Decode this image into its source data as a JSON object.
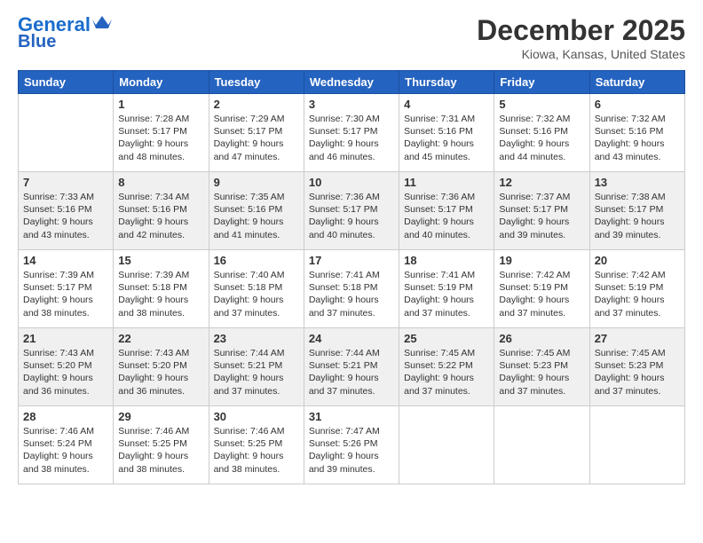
{
  "header": {
    "logo_line1": "General",
    "logo_line2": "Blue",
    "month": "December 2025",
    "location": "Kiowa, Kansas, United States"
  },
  "weekdays": [
    "Sunday",
    "Monday",
    "Tuesday",
    "Wednesday",
    "Thursday",
    "Friday",
    "Saturday"
  ],
  "weeks": [
    [
      {
        "day": "",
        "info": ""
      },
      {
        "day": "1",
        "info": "Sunrise: 7:28 AM\nSunset: 5:17 PM\nDaylight: 9 hours\nand 48 minutes."
      },
      {
        "day": "2",
        "info": "Sunrise: 7:29 AM\nSunset: 5:17 PM\nDaylight: 9 hours\nand 47 minutes."
      },
      {
        "day": "3",
        "info": "Sunrise: 7:30 AM\nSunset: 5:17 PM\nDaylight: 9 hours\nand 46 minutes."
      },
      {
        "day": "4",
        "info": "Sunrise: 7:31 AM\nSunset: 5:16 PM\nDaylight: 9 hours\nand 45 minutes."
      },
      {
        "day": "5",
        "info": "Sunrise: 7:32 AM\nSunset: 5:16 PM\nDaylight: 9 hours\nand 44 minutes."
      },
      {
        "day": "6",
        "info": "Sunrise: 7:32 AM\nSunset: 5:16 PM\nDaylight: 9 hours\nand 43 minutes."
      }
    ],
    [
      {
        "day": "7",
        "info": "Sunrise: 7:33 AM\nSunset: 5:16 PM\nDaylight: 9 hours\nand 43 minutes."
      },
      {
        "day": "8",
        "info": "Sunrise: 7:34 AM\nSunset: 5:16 PM\nDaylight: 9 hours\nand 42 minutes."
      },
      {
        "day": "9",
        "info": "Sunrise: 7:35 AM\nSunset: 5:16 PM\nDaylight: 9 hours\nand 41 minutes."
      },
      {
        "day": "10",
        "info": "Sunrise: 7:36 AM\nSunset: 5:17 PM\nDaylight: 9 hours\nand 40 minutes."
      },
      {
        "day": "11",
        "info": "Sunrise: 7:36 AM\nSunset: 5:17 PM\nDaylight: 9 hours\nand 40 minutes."
      },
      {
        "day": "12",
        "info": "Sunrise: 7:37 AM\nSunset: 5:17 PM\nDaylight: 9 hours\nand 39 minutes."
      },
      {
        "day": "13",
        "info": "Sunrise: 7:38 AM\nSunset: 5:17 PM\nDaylight: 9 hours\nand 39 minutes."
      }
    ],
    [
      {
        "day": "14",
        "info": "Sunrise: 7:39 AM\nSunset: 5:17 PM\nDaylight: 9 hours\nand 38 minutes."
      },
      {
        "day": "15",
        "info": "Sunrise: 7:39 AM\nSunset: 5:18 PM\nDaylight: 9 hours\nand 38 minutes."
      },
      {
        "day": "16",
        "info": "Sunrise: 7:40 AM\nSunset: 5:18 PM\nDaylight: 9 hours\nand 37 minutes."
      },
      {
        "day": "17",
        "info": "Sunrise: 7:41 AM\nSunset: 5:18 PM\nDaylight: 9 hours\nand 37 minutes."
      },
      {
        "day": "18",
        "info": "Sunrise: 7:41 AM\nSunset: 5:19 PM\nDaylight: 9 hours\nand 37 minutes."
      },
      {
        "day": "19",
        "info": "Sunrise: 7:42 AM\nSunset: 5:19 PM\nDaylight: 9 hours\nand 37 minutes."
      },
      {
        "day": "20",
        "info": "Sunrise: 7:42 AM\nSunset: 5:19 PM\nDaylight: 9 hours\nand 37 minutes."
      }
    ],
    [
      {
        "day": "21",
        "info": "Sunrise: 7:43 AM\nSunset: 5:20 PM\nDaylight: 9 hours\nand 36 minutes."
      },
      {
        "day": "22",
        "info": "Sunrise: 7:43 AM\nSunset: 5:20 PM\nDaylight: 9 hours\nand 36 minutes."
      },
      {
        "day": "23",
        "info": "Sunrise: 7:44 AM\nSunset: 5:21 PM\nDaylight: 9 hours\nand 37 minutes."
      },
      {
        "day": "24",
        "info": "Sunrise: 7:44 AM\nSunset: 5:21 PM\nDaylight: 9 hours\nand 37 minutes."
      },
      {
        "day": "25",
        "info": "Sunrise: 7:45 AM\nSunset: 5:22 PM\nDaylight: 9 hours\nand 37 minutes."
      },
      {
        "day": "26",
        "info": "Sunrise: 7:45 AM\nSunset: 5:23 PM\nDaylight: 9 hours\nand 37 minutes."
      },
      {
        "day": "27",
        "info": "Sunrise: 7:45 AM\nSunset: 5:23 PM\nDaylight: 9 hours\nand 37 minutes."
      }
    ],
    [
      {
        "day": "28",
        "info": "Sunrise: 7:46 AM\nSunset: 5:24 PM\nDaylight: 9 hours\nand 38 minutes."
      },
      {
        "day": "29",
        "info": "Sunrise: 7:46 AM\nSunset: 5:25 PM\nDaylight: 9 hours\nand 38 minutes."
      },
      {
        "day": "30",
        "info": "Sunrise: 7:46 AM\nSunset: 5:25 PM\nDaylight: 9 hours\nand 38 minutes."
      },
      {
        "day": "31",
        "info": "Sunrise: 7:47 AM\nSunset: 5:26 PM\nDaylight: 9 hours\nand 39 minutes."
      },
      {
        "day": "",
        "info": ""
      },
      {
        "day": "",
        "info": ""
      },
      {
        "day": "",
        "info": ""
      }
    ]
  ]
}
